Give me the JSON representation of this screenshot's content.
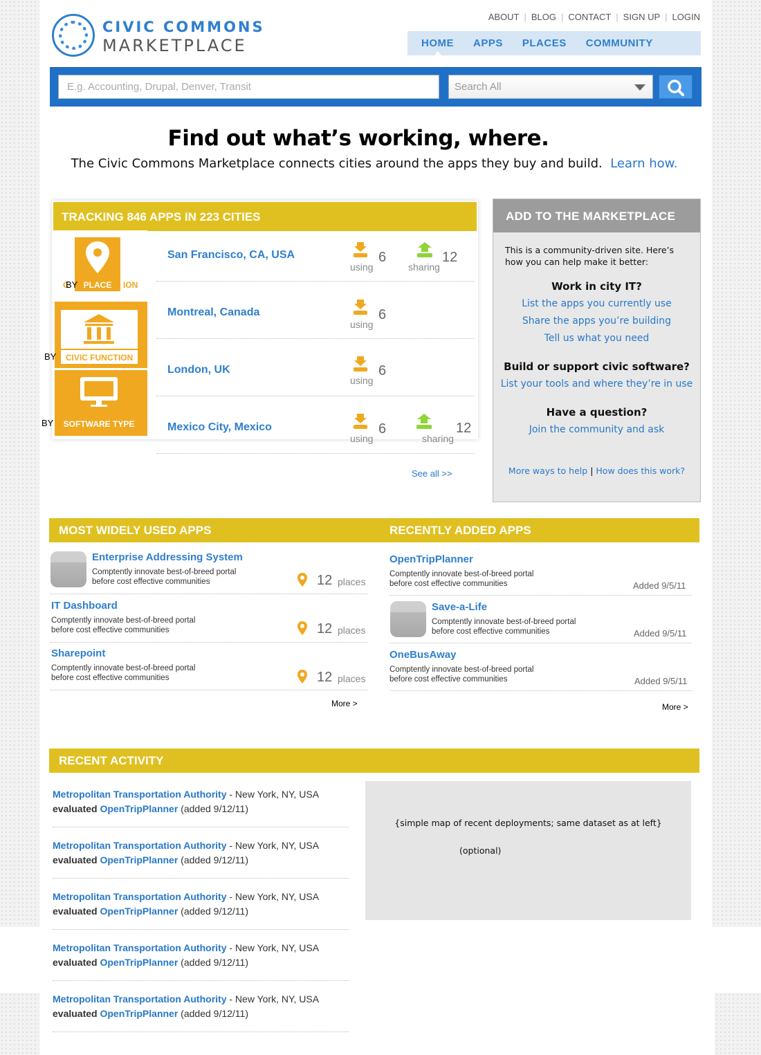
{
  "logo": {
    "line1": "CIVIC COMMONS",
    "line2": "MARKETPLACE",
    "mark_icon": "civic-commons-logo-icon"
  },
  "top_links": [
    "ABOUT",
    "BLOG",
    "CONTACT",
    "SIGN UP",
    "LOGIN"
  ],
  "main_nav": [
    "HOME",
    "APPS",
    "PLACES",
    "COMMUNITY"
  ],
  "search": {
    "placeholder": "E.g. Accounting, Drupal, Denver, Transit",
    "scope_value": "Search All",
    "button_icon": "search-icon"
  },
  "hero": {
    "headline": "Find out what’s working, where.",
    "subline": "The Civic Commons Marketplace connects cities around the apps they buy and build.",
    "learn_link": "Learn how."
  },
  "tracking": {
    "title": "TRACKING 846 APPS IN 223 CITIES",
    "tabs": [
      {
        "by": "BY",
        "label": "PLACE",
        "behind_text_left": "C",
        "behind_text_right": "ION",
        "icon": "map-pin-icon"
      },
      {
        "by": "BY",
        "label": "CIVIC FUNCTION",
        "icon": "government-building-icon"
      },
      {
        "by": "BY",
        "label": "SOFTWARE TYPE",
        "icon": "computer-monitor-icon"
      }
    ],
    "cities": [
      {
        "name": "San Francisco, CA, USA",
        "using": "6",
        "using_label": "using",
        "sharing": "12",
        "sharing_label": "sharing"
      },
      {
        "name": "Montreal, Canada",
        "using": "6",
        "using_label": "using"
      },
      {
        "name": "London, UK",
        "using": "6",
        "using_label": "using"
      },
      {
        "name": "Mexico City, Mexico",
        "using": "6",
        "using_label": "using",
        "sharing": "12",
        "sharing_label": "sharing"
      }
    ],
    "see_all": "See all >>"
  },
  "add_box": {
    "title": "ADD  TO THE MARKETPLACE",
    "intro": "This is a community-driven site.  Here’s how you can help make it better:",
    "sections": [
      {
        "heading": "Work in city IT?",
        "links": [
          "List the apps you currently use",
          "Share the apps you’re building",
          "Tell us what you need"
        ]
      },
      {
        "heading": "Build or support civic software?",
        "links": [
          "List your tools and where they’re in use"
        ]
      },
      {
        "heading": "Have a question?",
        "links": [
          "Join the community and ask"
        ]
      }
    ],
    "footer_link1": "More ways to help",
    "footer_sep": "|",
    "footer_link2": "How does this work?"
  },
  "most_used": {
    "title": "MOST WIDELY USED APPS",
    "apps": [
      {
        "name": "Enterprise Addressing System",
        "desc1": "Comptently innovate best-of-breed portal",
        "desc2": "before cost effective communities",
        "count": "12",
        "unit": "places"
      },
      {
        "name": "IT Dashboard",
        "desc1": "Comptently innovate best-of-breed portal",
        "desc2": "before cost effective communities",
        "count": "12",
        "unit": "places"
      },
      {
        "name": "Sharepoint",
        "desc1": "Comptently innovate best-of-breed portal",
        "desc2": "before cost effective communities",
        "count": "12",
        "unit": "places"
      }
    ],
    "more": "More >"
  },
  "recently_added": {
    "title": "RECENTLY ADDED APPS",
    "apps": [
      {
        "name": "OpenTripPlanner",
        "desc1": "Comptently innovate best-of-breed portal",
        "desc2": "before cost effective communities",
        "added": "Added 9/5/11"
      },
      {
        "name": "Save-a-Life",
        "desc1": "Comptently innovate best-of-breed portal",
        "desc2": "before cost effective communities",
        "added": "Added 9/5/11"
      },
      {
        "name": "OneBusAway",
        "desc1": "Comptently innovate best-of-breed portal",
        "desc2": "before cost effective communities",
        "added": "Added 9/5/11"
      }
    ],
    "more": "More >"
  },
  "recent_activity": {
    "title": "RECENT ACTIVITY",
    "items": [
      {
        "org": "Metropolitan Transportation Authority",
        "location": " - New York, NY, USA",
        "verb": "evaluated ",
        "app": "OpenTripPlanner",
        "added": " (added 9/12/11)"
      },
      {
        "org": "Metropolitan Transportation Authority",
        "location": " - New York, NY, USA",
        "verb": "evaluated ",
        "app": "OpenTripPlanner",
        "added": " (added 9/12/11)"
      },
      {
        "org": "Metropolitan Transportation Authority",
        "location": " - New York, NY, USA",
        "verb": "evaluated ",
        "app": "OpenTripPlanner",
        "added": " (added 9/12/11)"
      },
      {
        "org": "Metropolitan Transportation Authority",
        "location": " - New York, NY, USA",
        "verb": "evaluated ",
        "app": "OpenTripPlanner",
        "added": " (added 9/12/11)"
      },
      {
        "org": "Metropolitan Transportation Authority",
        "location": " - New York, NY, USA",
        "verb": "evaluated ",
        "app": "OpenTripPlanner",
        "added": " (added 9/12/11)"
      }
    ],
    "map_note": "{simple map of recent deployments; same dataset as at left}",
    "map_optional": "(optional)"
  },
  "colors": {
    "accent_blue": "#2f7fce",
    "bar_yellow": "#e0c020",
    "tile_orange": "#f0a820",
    "sharing_green": "#8fd43a"
  }
}
